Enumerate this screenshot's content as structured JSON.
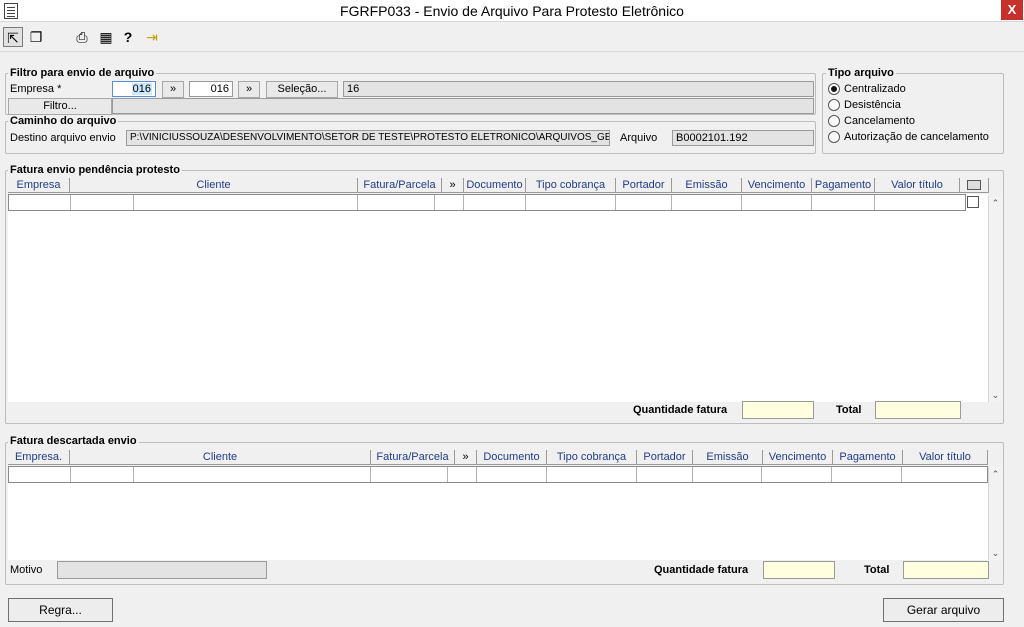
{
  "window": {
    "title": "FGRFP033 - Envio de Arquivo Para Protesto Eletrônico",
    "close": "X"
  },
  "toolbar": {
    "icons": [
      "select-icon",
      "copy-icon",
      "print-icon",
      "calc-icon",
      "help-icon",
      "exit-icon"
    ],
    "glyphs": {
      "select": "⇱",
      "copy": "❐",
      "print": "⎙",
      "calc": "▦",
      "help": "?",
      "exit": "⇥"
    }
  },
  "filtro": {
    "title": "Filtro para envio de arquivo",
    "empresa_label": "Empresa *",
    "empresa_from": "016",
    "empresa_to": "016",
    "arrow_label": "»",
    "selecao_label": "Seleção...",
    "selecao_value": "16",
    "filtro_label": "Filtro..."
  },
  "caminho": {
    "title": "Caminho do arquivo",
    "destino_label": "Destino arquivo envio",
    "destino_value": "P:\\VINICIUSSOUZA\\DESENVOLVIMENTO\\SETOR DE TESTE\\PROTESTO ELETRONICO\\ARQUIVOS_GE",
    "arquivo_label": "Arquivo",
    "arquivo_value": "B0002101.192"
  },
  "tipo": {
    "title": "Tipo arquivo",
    "options": [
      "Centralizado",
      "Desistência",
      "Cancelamento",
      "Autorização de cancelamento"
    ],
    "selected": "Centralizado"
  },
  "pendencia": {
    "title": "Fatura envio pendência protesto",
    "columns": [
      "Empresa",
      "Cliente",
      "Fatura/Parcela",
      "»",
      "Documento",
      "Tipo cobrança",
      "Portador",
      "Emissão",
      "Vencimento",
      "Pagamento",
      "Valor título"
    ],
    "qtd_label": "Quantidade fatura",
    "total_label": "Total"
  },
  "descartada": {
    "title": "Fatura descartada envio",
    "columns": [
      "Empresa.",
      "Cliente",
      "Fatura/Parcela",
      "»",
      "Documento",
      "Tipo cobrança",
      "Portador",
      "Emissão",
      "Vencimento",
      "Pagamento",
      "Valor título"
    ],
    "motivo_label": "Motivo",
    "qtd_label": "Quantidade fatura",
    "total_label": "Total"
  },
  "footer": {
    "regra_label": "Regra...",
    "gerar_label": "Gerar arquivo"
  },
  "colors": {
    "header_text": "#1f3c88",
    "highlight_field": "#ffffe0",
    "close_button": "#c7312b"
  }
}
